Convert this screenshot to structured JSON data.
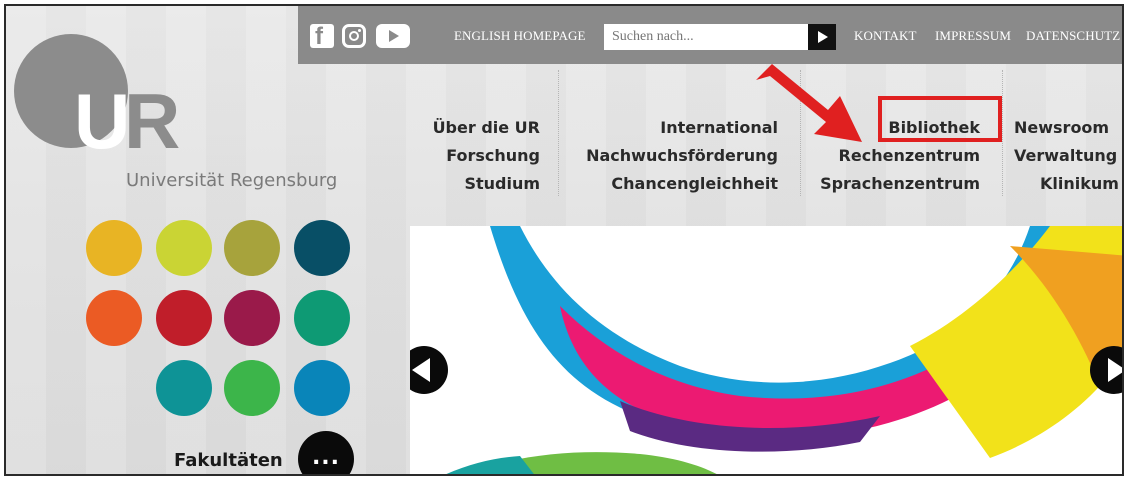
{
  "topbar": {
    "social": [
      {
        "icon": "facebook-icon",
        "glyph": "f"
      },
      {
        "icon": "instagram-icon"
      },
      {
        "icon": "youtube-icon"
      }
    ],
    "english_homepage": "ENGLISH HOMEPAGE",
    "search_placeholder": "Suchen nach...",
    "links": [
      "KONTAKT",
      "IMPRESSUM",
      "DATENSCHUTZ"
    ]
  },
  "logo": {
    "letter_u": "U",
    "letter_r": "R",
    "name": "Universität Regensburg"
  },
  "nav": {
    "columns": [
      [
        "Über die UR",
        "Forschung",
        "Studium"
      ],
      [
        "International",
        "Nachwuchsförderung",
        "Chancengleichheit"
      ],
      [
        "Bibliothek",
        "Rechenzentrum",
        "Sprachenzentrum"
      ],
      [
        "Newsroom",
        "Verwaltung",
        "Klinikum"
      ]
    ],
    "highlighted": "Bibliothek",
    "highlight_color": "#e02020"
  },
  "faculties": {
    "label": "Fakultäten",
    "more_glyph": "...",
    "colors": [
      "#e8b424",
      "#cad434",
      "#a7a33c",
      "#084f66",
      "#eb5b24",
      "#c01e2a",
      "#9a1a4a",
      "#0e9a74",
      "#0e9396",
      "#3cb54a",
      "#0985b9"
    ]
  },
  "colors": {
    "topbar": "#8a8a8a",
    "logo_grey": "#8c8c8c"
  }
}
